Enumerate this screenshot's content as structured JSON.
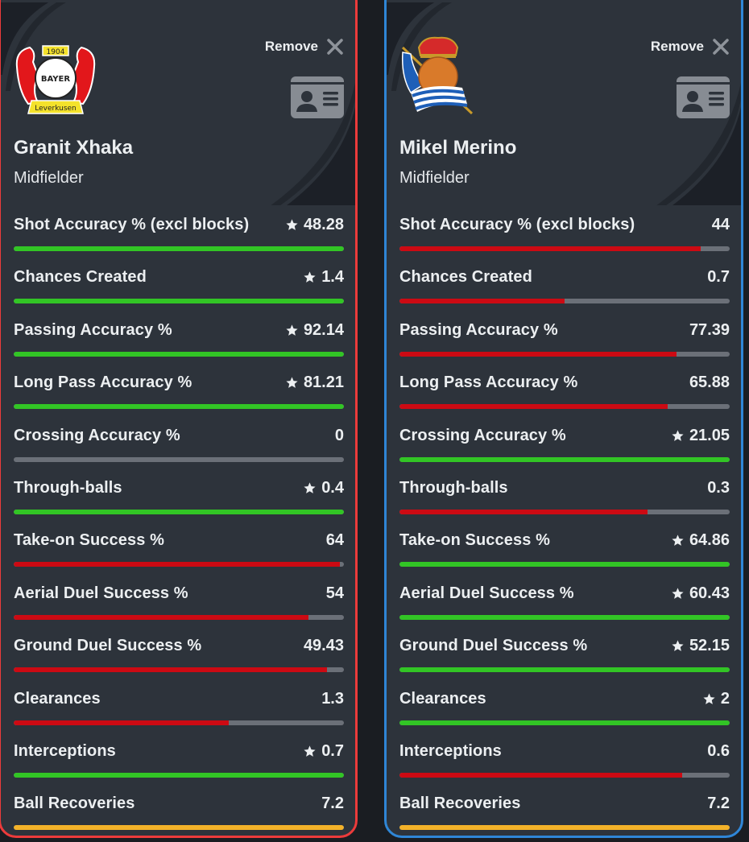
{
  "colors": {
    "better": "#32c525",
    "worse": "#cc0a13",
    "equal": "#f3b229",
    "track": "#6b7078",
    "left_border": "#ec3b3b",
    "right_border": "#2f86d6"
  },
  "players": [
    {
      "name": "Granit Xhaka",
      "position": "Midfielder",
      "club_crest": "bayer-leverkusen-crest",
      "crest_text": {
        "year": "1904",
        "center": "BAYER",
        "banner": "Leverkusen"
      },
      "remove_label": "Remove",
      "stats": [
        {
          "label": "Shot Accuracy % (excl blocks)",
          "value": "48.28",
          "star": true
        },
        {
          "label": "Chances Created",
          "value": "1.4",
          "star": true
        },
        {
          "label": "Passing Accuracy %",
          "value": "92.14",
          "star": true
        },
        {
          "label": "Long Pass Accuracy %",
          "value": "81.21",
          "star": true
        },
        {
          "label": "Crossing Accuracy %",
          "value": "0",
          "star": false
        },
        {
          "label": "Through-balls",
          "value": "0.4",
          "star": true
        },
        {
          "label": "Take-on Success %",
          "value": "64",
          "star": false
        },
        {
          "label": "Aerial Duel Success %",
          "value": "54",
          "star": false
        },
        {
          "label": "Ground Duel Success %",
          "value": "49.43",
          "star": false
        },
        {
          "label": "Clearances",
          "value": "1.3",
          "star": false
        },
        {
          "label": "Interceptions",
          "value": "0.7",
          "star": true
        },
        {
          "label": "Ball Recoveries",
          "value": "7.2",
          "star": false
        }
      ]
    },
    {
      "name": "Mikel Merino",
      "position": "Midfielder",
      "club_crest": "real-sociedad-crest",
      "remove_label": "Remove",
      "stats": [
        {
          "label": "Shot Accuracy % (excl blocks)",
          "value": "44",
          "star": false
        },
        {
          "label": "Chances Created",
          "value": "0.7",
          "star": false
        },
        {
          "label": "Passing Accuracy %",
          "value": "77.39",
          "star": false
        },
        {
          "label": "Long Pass Accuracy %",
          "value": "65.88",
          "star": false
        },
        {
          "label": "Crossing Accuracy %",
          "value": "21.05",
          "star": true
        },
        {
          "label": "Through-balls",
          "value": "0.3",
          "star": false
        },
        {
          "label": "Take-on Success %",
          "value": "64.86",
          "star": true
        },
        {
          "label": "Aerial Duel Success %",
          "value": "60.43",
          "star": true
        },
        {
          "label": "Ground Duel Success %",
          "value": "52.15",
          "star": true
        },
        {
          "label": "Clearances",
          "value": "2",
          "star": true
        },
        {
          "label": "Interceptions",
          "value": "0.6",
          "star": false
        },
        {
          "label": "Ball Recoveries",
          "value": "7.2",
          "star": false
        }
      ]
    }
  ]
}
